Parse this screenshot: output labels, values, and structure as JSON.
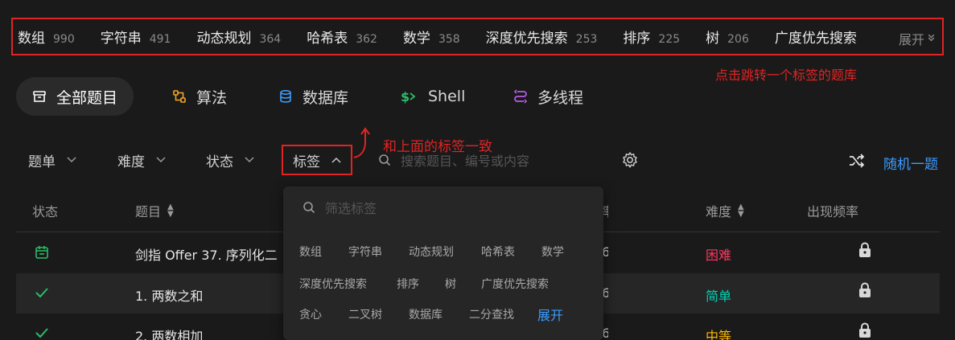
{
  "tagbar": {
    "tags": [
      {
        "name": "数组",
        "count": "990"
      },
      {
        "name": "字符串",
        "count": "491"
      },
      {
        "name": "动态规划",
        "count": "364"
      },
      {
        "name": "哈希表",
        "count": "362"
      },
      {
        "name": "数学",
        "count": "358"
      },
      {
        "name": "深度优先搜索",
        "count": "253"
      },
      {
        "name": "排序",
        "count": "225"
      },
      {
        "name": "树",
        "count": "206"
      },
      {
        "name": "广度优先搜索",
        "count": ""
      }
    ],
    "expand_label": "展开"
  },
  "annotations": {
    "tagbar_note": "点击跳转一个标签的题库",
    "filter_note": "和上面的标签一致"
  },
  "categories": {
    "all": "全部题目",
    "algo": "算法",
    "db": "数据库",
    "shell": "Shell",
    "thread": "多线程"
  },
  "filters": {
    "list": "题单",
    "difficulty": "难度",
    "status": "状态",
    "tags": "标签"
  },
  "search": {
    "placeholder": "搜索题目、编号或内容"
  },
  "random": {
    "label": "随机一题"
  },
  "table": {
    "headers": {
      "status": "状态",
      "title": "题目",
      "difficulty": "难度",
      "frequency": "出现频率"
    },
    "rows": [
      {
        "title": "剑指 Offer 37. 序列化二",
        "difficulty": "困难",
        "diff_color": "#ff375f"
      },
      {
        "title": "1. 两数之和",
        "difficulty": "简单",
        "diff_color": "#00d4b5"
      },
      {
        "title": "2. 两数相加",
        "difficulty": "中等",
        "diff_color": "#ffb800"
      }
    ]
  },
  "dropdown": {
    "placeholder": "筛选标签",
    "rows": [
      [
        "数组",
        "字符串",
        "动态规划",
        "哈希表",
        "数学"
      ],
      [
        "深度优先搜索",
        "排序",
        "树",
        "广度优先搜索"
      ],
      [
        "贪心",
        "二叉树",
        "数据库",
        "二分查找"
      ]
    ],
    "expand_label": "展开"
  },
  "colors": {
    "accent": "#3b9cff",
    "annotation": "#e02424"
  }
}
